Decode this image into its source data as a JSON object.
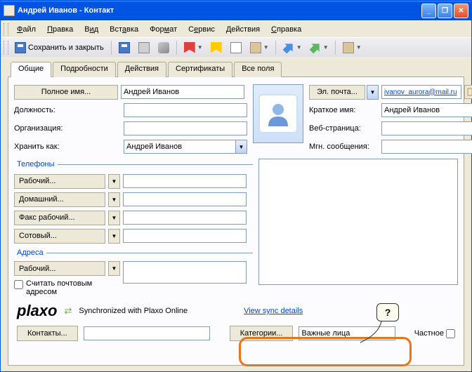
{
  "window": {
    "title": "Андрей Иванов - Контакт"
  },
  "menu": {
    "file": "Файл",
    "edit": "Правка",
    "view": "Вид",
    "insert": "Вставка",
    "format": "Формат",
    "tools": "Сервис",
    "actions": "Действия",
    "help": "Справка"
  },
  "toolbar": {
    "save_close": "Сохранить и закрыть"
  },
  "tabs": {
    "general": "Общие",
    "details": "Подробности",
    "activities": "Действия",
    "certs": "Сертификаты",
    "all": "Все поля"
  },
  "labels": {
    "full_name_btn": "Полное имя...",
    "job": "Должность:",
    "org": "Организация:",
    "file_as": "Хранить как:",
    "phones": "Телефоны",
    "work": "Рабочий...",
    "home": "Домашний...",
    "fax": "Факс рабочий...",
    "mobile": "Сотовый...",
    "addresses": "Адреса",
    "addr_work": "Рабочий...",
    "mail_addr": "Считать почтовым адресом",
    "email_btn": "Эл. почта...",
    "display_as": "Краткое имя:",
    "web": "Веб-страница:",
    "im": "Мгн. сообщения:",
    "contacts_btn": "Контакты...",
    "categories_btn": "Категории...",
    "private": "Частное"
  },
  "values": {
    "full_name": "Андрей Иванов",
    "job": "",
    "org": "",
    "file_as": "Андрей Иванов",
    "email": "ivanov_aurora@mail.ru",
    "display_as": "Андрей Иванов",
    "web": "",
    "im": "",
    "phone_work": "",
    "phone_home": "",
    "phone_fax": "",
    "phone_mobile": "",
    "addr": "",
    "categories": "Важные лица",
    "contacts": ""
  },
  "plaxo": {
    "synced": "Synchronized with Plaxo Online",
    "view": "View sync details",
    "logo": "plaxo"
  },
  "callout": {
    "q": "?"
  }
}
